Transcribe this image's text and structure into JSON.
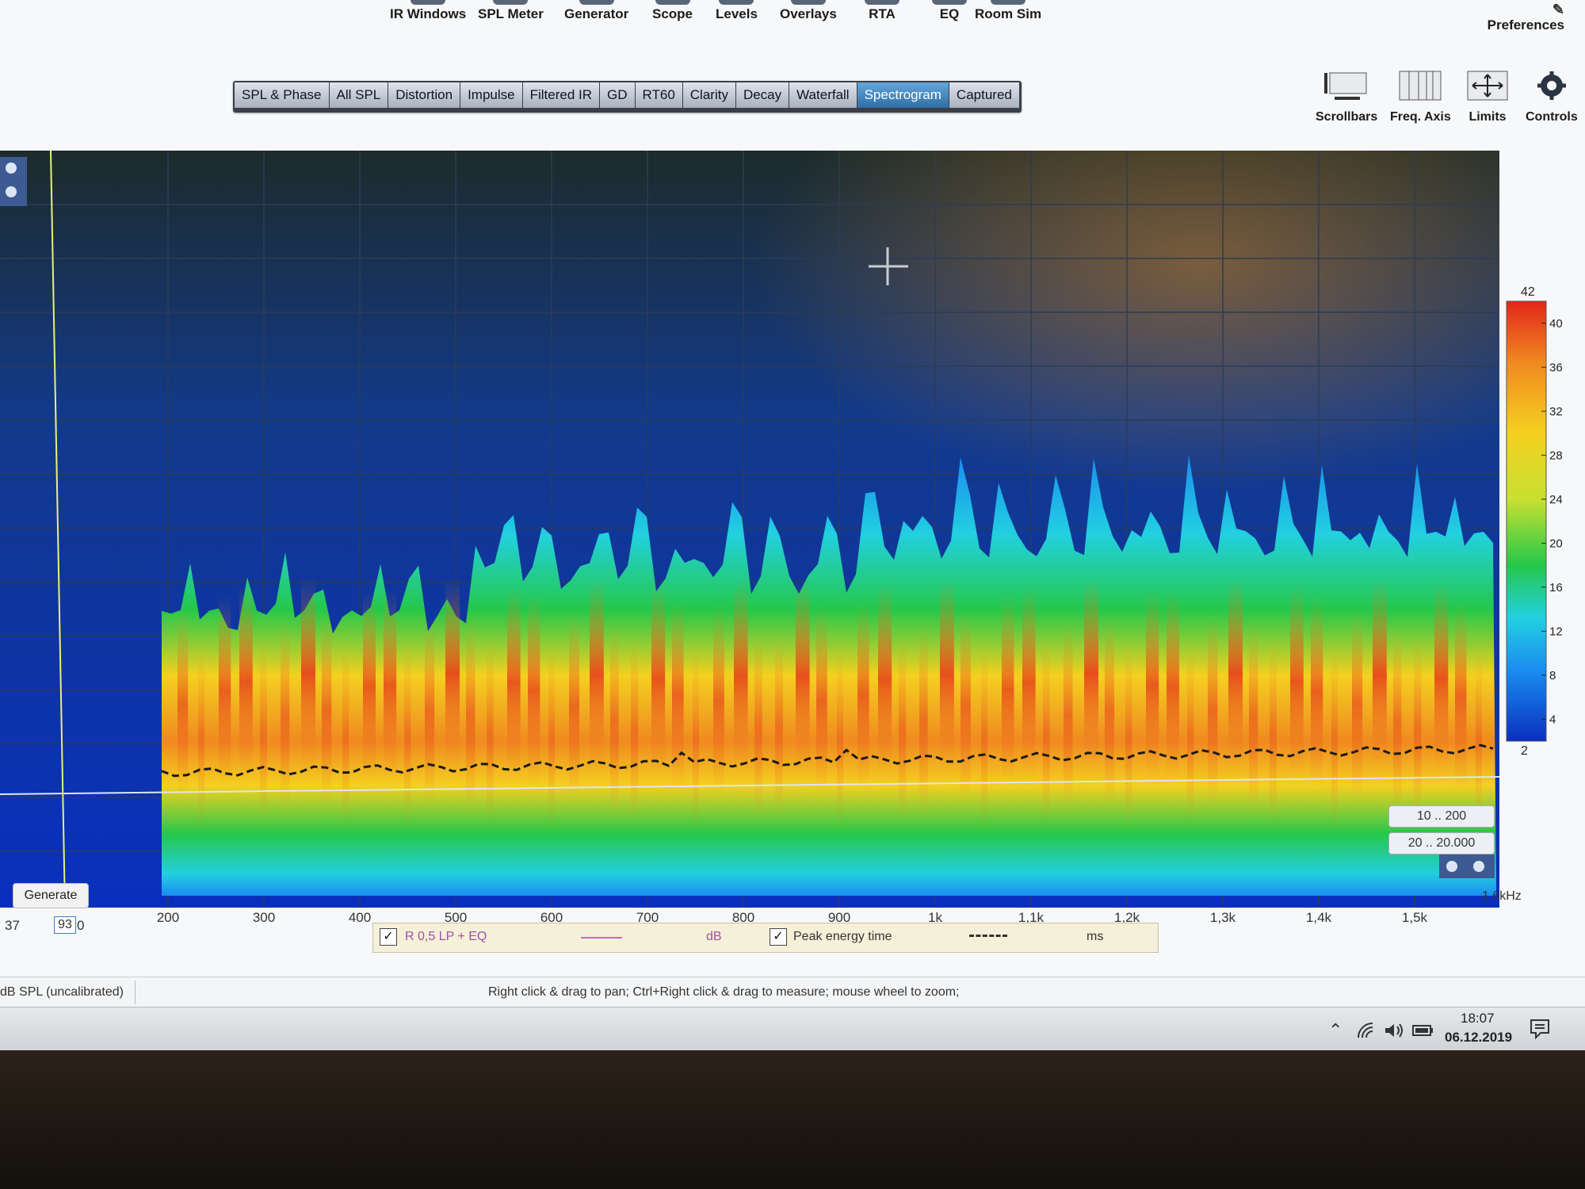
{
  "toolbar": {
    "items": [
      {
        "label": "IR Windows"
      },
      {
        "label": "SPL Meter"
      },
      {
        "label": "Generator"
      },
      {
        "label": "Scope"
      },
      {
        "label": "Levels"
      },
      {
        "label": "Overlays"
      },
      {
        "label": "RTA"
      },
      {
        "label": "EQ"
      },
      {
        "label": "Room Sim"
      }
    ],
    "preferences": "Preferences"
  },
  "tabs": {
    "items": [
      {
        "label": "SPL & Phase"
      },
      {
        "label": "All SPL"
      },
      {
        "label": "Distortion"
      },
      {
        "label": "Impulse"
      },
      {
        "label": "Filtered IR"
      },
      {
        "label": "GD"
      },
      {
        "label": "RT60"
      },
      {
        "label": "Clarity"
      },
      {
        "label": "Decay"
      },
      {
        "label": "Waterfall"
      },
      {
        "label": "Spectrogram",
        "active": true
      },
      {
        "label": "Captured"
      }
    ]
  },
  "right_tools": {
    "scrollbars": "Scrollbars",
    "freq_axis": "Freq. Axis",
    "limits": "Limits",
    "controls": "Controls"
  },
  "chart_data": {
    "type": "heatmap",
    "title": "",
    "xlabel": "",
    "x_unit": "1,6kHz",
    "x_ticks": [
      "200",
      "300",
      "400",
      "500",
      "600",
      "700",
      "800",
      "900",
      "1k",
      "1,1k",
      "1,2k",
      "1,3k",
      "1,4k",
      "1,5k"
    ],
    "x_min_label": "37",
    "x_cursor_label": "93",
    "x_cursor_suffix": "0",
    "xlim": [
      37,
      1600
    ],
    "colorscale": {
      "top_label": "42",
      "bottom_label": "2",
      "ticks": [
        "40",
        "36",
        "32",
        "28",
        "24",
        "20",
        "16",
        "12",
        "8",
        "4"
      ],
      "range": [
        2,
        42
      ],
      "colors": [
        "#0a2fbf",
        "#1a8cf0",
        "#22d0e0",
        "#25c84a",
        "#c8e030",
        "#f4d020",
        "#f08a20",
        "#e2261a"
      ]
    },
    "peak_energy_time_ms_trend": "roughly constant across frequency",
    "grid": true
  },
  "range_buttons": {
    "time": "10 .. 200",
    "freq": "20 .. 20.000"
  },
  "generate_button": "Generate",
  "legend": {
    "checked": "✓",
    "trace_name": "R 0,5 LP + EQ",
    "trace_unit": "dB",
    "peak_label": "Peak energy time",
    "peak_unit": "ms"
  },
  "status": {
    "left": "dB SPL (uncalibrated)",
    "hint": "Right click & drag to pan; Ctrl+Right click & drag to measure; mouse wheel to zoom;"
  },
  "taskbar": {
    "time": "18:07",
    "date": "06.12.2019",
    "icons": [
      "chevron-up-icon",
      "wifi-icon",
      "volume-icon",
      "battery-icon",
      "notification-icon"
    ]
  }
}
